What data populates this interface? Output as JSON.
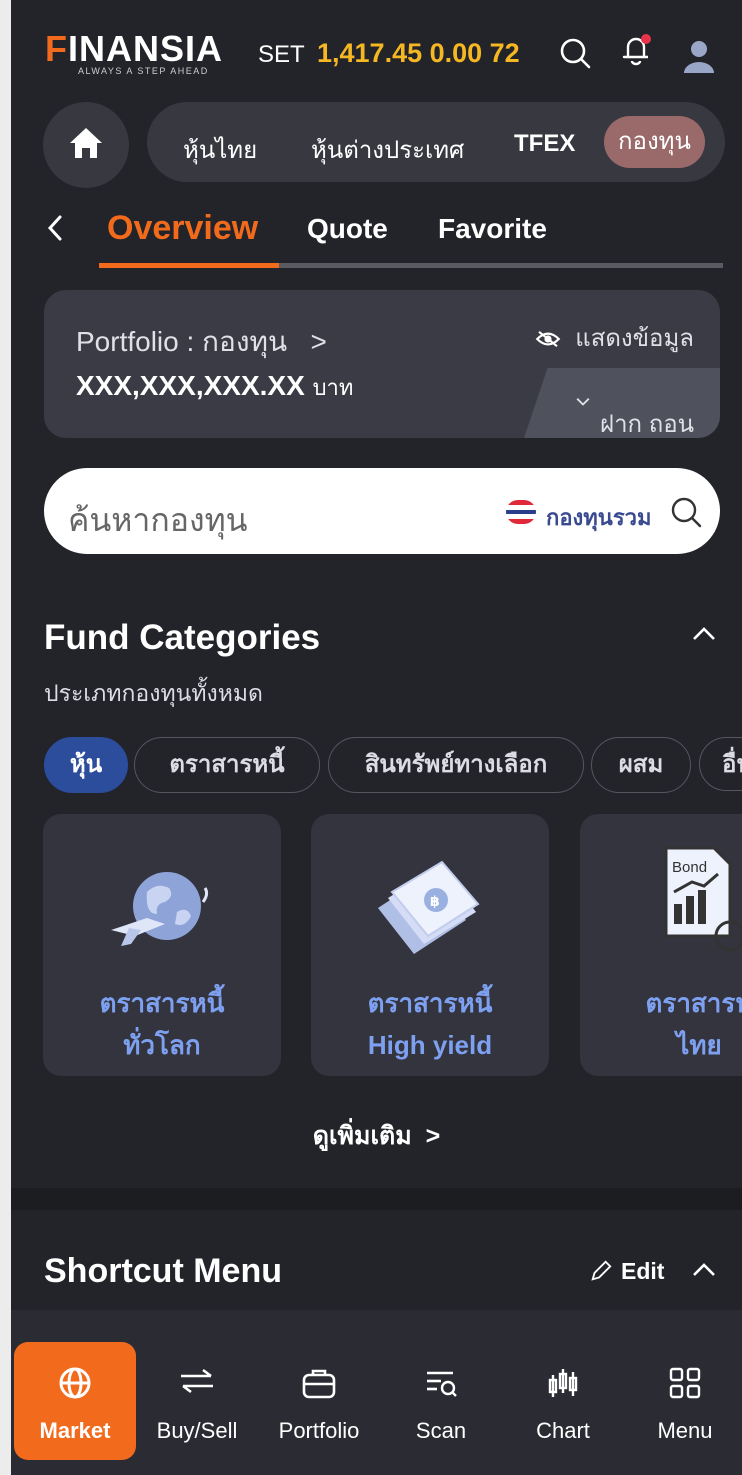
{
  "header": {
    "logo_rest": "INANSIA",
    "logo_f": "F",
    "tagline": "ALWAYS A STEP AHEAD",
    "set_label": "SET",
    "set_values": "1,417.45 0.00 72"
  },
  "main_tabs": [
    {
      "label": "หุ้นไทย"
    },
    {
      "label": "หุ้นต่างประเทศ"
    },
    {
      "label": "TFEX"
    },
    {
      "label": "กองทุน"
    }
  ],
  "sub_tabs": [
    {
      "label": "Overview"
    },
    {
      "label": "Quote"
    },
    {
      "label": "Favorite"
    }
  ],
  "portfolio": {
    "title": "Portfolio : กองทุน",
    "chevron": ">",
    "value": "XXX,XXX,XXX.XX",
    "unit": "บาท",
    "show_data": "แสดงข้อมูล",
    "deposit_withdraw": "ฝาก ถอน"
  },
  "search": {
    "placeholder": "ค้นหากองทุน",
    "scope": "กองทุนรวม"
  },
  "fund_categories": {
    "title": "Fund Categories",
    "subtitle": "ประเภทกองทุนทั้งหมด",
    "chips": [
      {
        "label": "หุ้น"
      },
      {
        "label": "ตราสารหนี้"
      },
      {
        "label": "สินทรัพย์ทางเลือก"
      },
      {
        "label": "ผสม"
      },
      {
        "label": "อื่น"
      }
    ],
    "cards": [
      {
        "label": "ตราสารหนี้\nทั่วโลก",
        "icon": "globe-icon"
      },
      {
        "label": "ตราสารหนี้\nHigh yield",
        "icon": "banknotes-icon"
      },
      {
        "label": "ตราสารห\nไทย",
        "icon": "bond-document-icon",
        "badge": "Bond"
      }
    ],
    "see_more": "ดูเพิ่มเติม"
  },
  "shortcut": {
    "title": "Shortcut Menu",
    "edit": "Edit"
  },
  "bottom_nav": [
    {
      "label": "Market",
      "icon": "globe-icon"
    },
    {
      "label": "Buy/Sell",
      "icon": "swap-arrows-icon"
    },
    {
      "label": "Portfolio",
      "icon": "briefcase-icon"
    },
    {
      "label": "Scan",
      "icon": "scan-list-icon"
    },
    {
      "label": "Chart",
      "icon": "candlestick-icon"
    },
    {
      "label": "Menu",
      "icon": "grid-menu-icon"
    }
  ],
  "colors": {
    "accent": "#f26b1d",
    "set_value": "#f5b823",
    "chip_active": "#2b4d9c",
    "card_label": "#7ea0f0",
    "notification_dot": "#e8344a"
  }
}
